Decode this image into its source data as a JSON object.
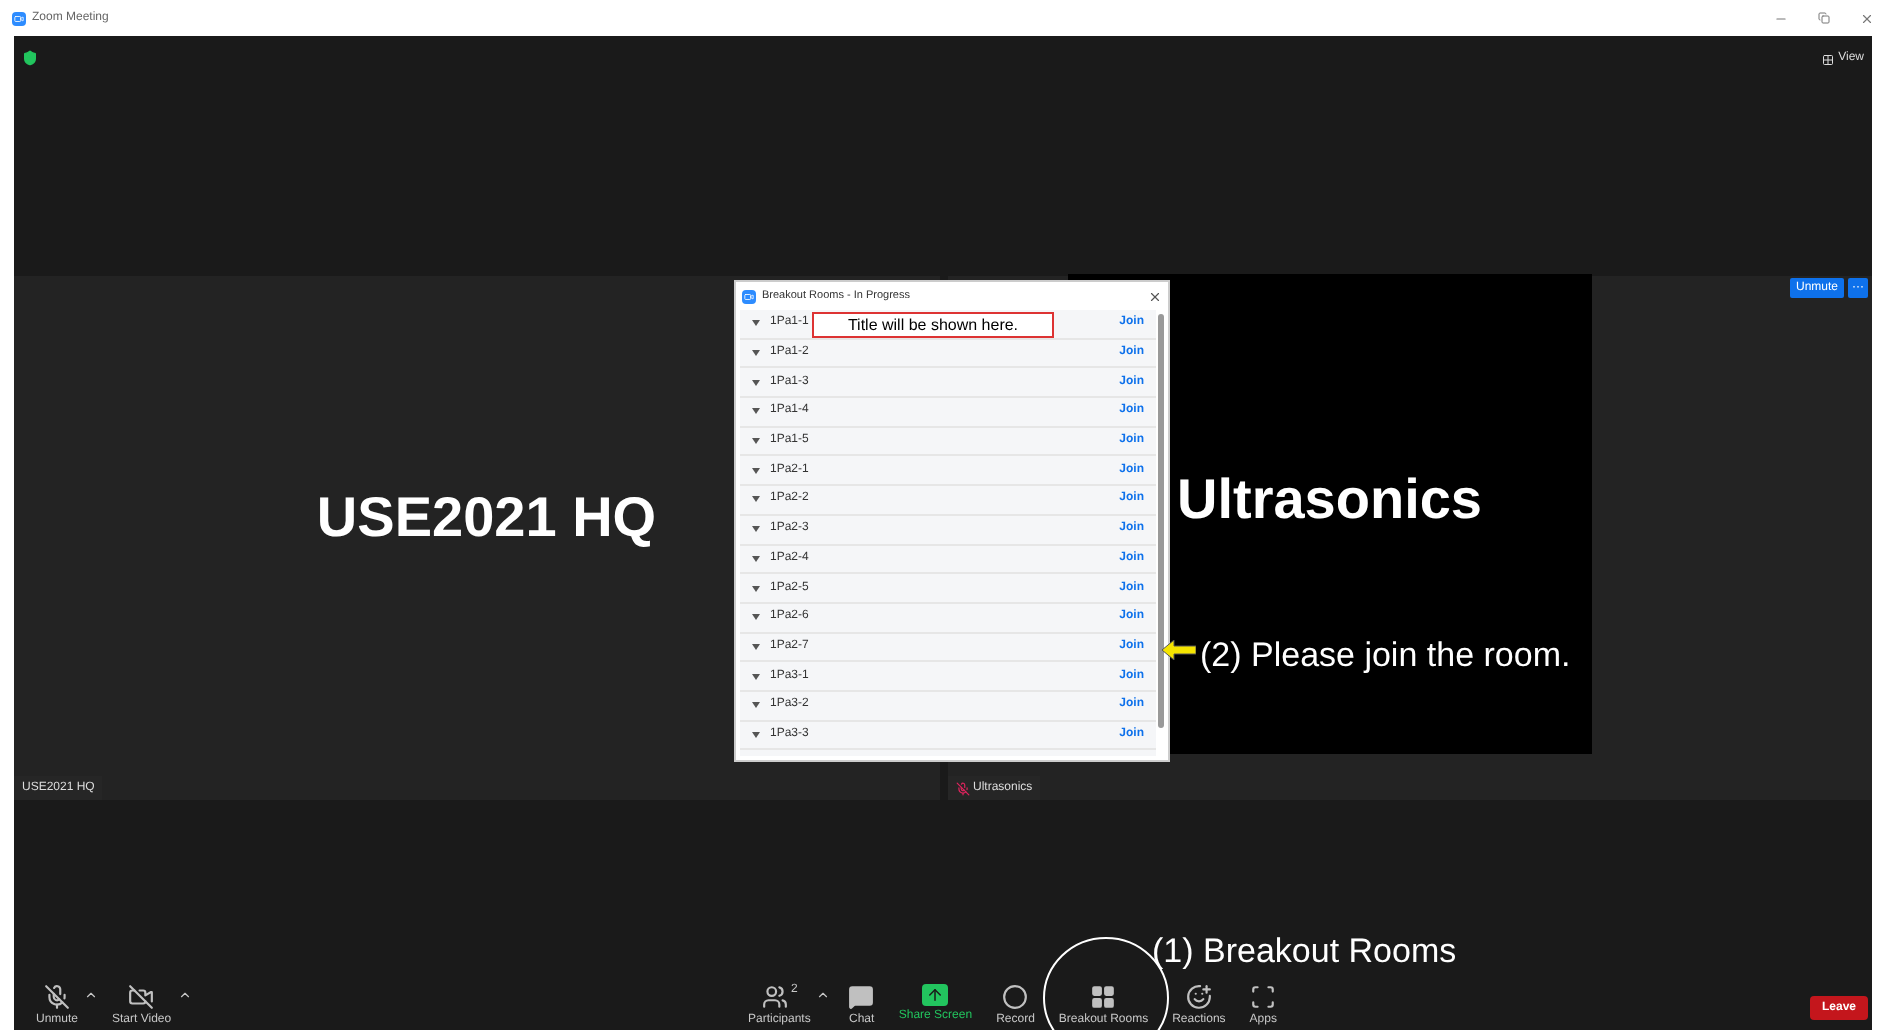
{
  "window": {
    "title": "Zoom Meeting",
    "view_label": "View"
  },
  "tiles": [
    {
      "name": "USE2021 HQ",
      "label": "USE2021 HQ",
      "muted": false,
      "video": false
    },
    {
      "name": "Ultrasonics",
      "label": "Ultrasonics",
      "muted": true,
      "video": true,
      "unmute_button": "Unmute",
      "more_button": "···"
    }
  ],
  "breakout_dialog": {
    "title": "Breakout Rooms - In Progress",
    "rooms": [
      {
        "name": "1Pa1-1",
        "join": "Join"
      },
      {
        "name": "1Pa1-2",
        "join": "Join"
      },
      {
        "name": "1Pa1-3",
        "join": "Join"
      },
      {
        "name": "1Pa1-4",
        "join": "Join"
      },
      {
        "name": "1Pa1-5",
        "join": "Join"
      },
      {
        "name": "1Pa2-1",
        "join": "Join"
      },
      {
        "name": "1Pa2-2",
        "join": "Join"
      },
      {
        "name": "1Pa2-3",
        "join": "Join"
      },
      {
        "name": "1Pa2-4",
        "join": "Join"
      },
      {
        "name": "1Pa2-5",
        "join": "Join"
      },
      {
        "name": "1Pa2-6",
        "join": "Join"
      },
      {
        "name": "1Pa2-7",
        "join": "Join"
      },
      {
        "name": "1Pa3-1",
        "join": "Join"
      },
      {
        "name": "1Pa3-2",
        "join": "Join"
      },
      {
        "name": "1Pa3-3",
        "join": "Join"
      }
    ]
  },
  "annotations": {
    "title_note": "Title will be shown here.",
    "join_note": "(2) Please join the room.",
    "breakout_note": "(1) Breakout Rooms"
  },
  "toolbar": {
    "left": [
      {
        "kind": "mic",
        "label": "Unmute"
      },
      {
        "kind": "video",
        "label": "Start Video"
      }
    ],
    "center": [
      {
        "kind": "participants",
        "label": "Participants",
        "count": "2"
      },
      {
        "kind": "chat",
        "label": "Chat"
      },
      {
        "kind": "share",
        "label": "Share Screen"
      },
      {
        "kind": "record",
        "label": "Record"
      },
      {
        "kind": "breakout",
        "label": "Breakout Rooms"
      },
      {
        "kind": "reactions",
        "label": "Reactions"
      },
      {
        "kind": "apps",
        "label": "Apps"
      }
    ],
    "leave": "Leave"
  }
}
